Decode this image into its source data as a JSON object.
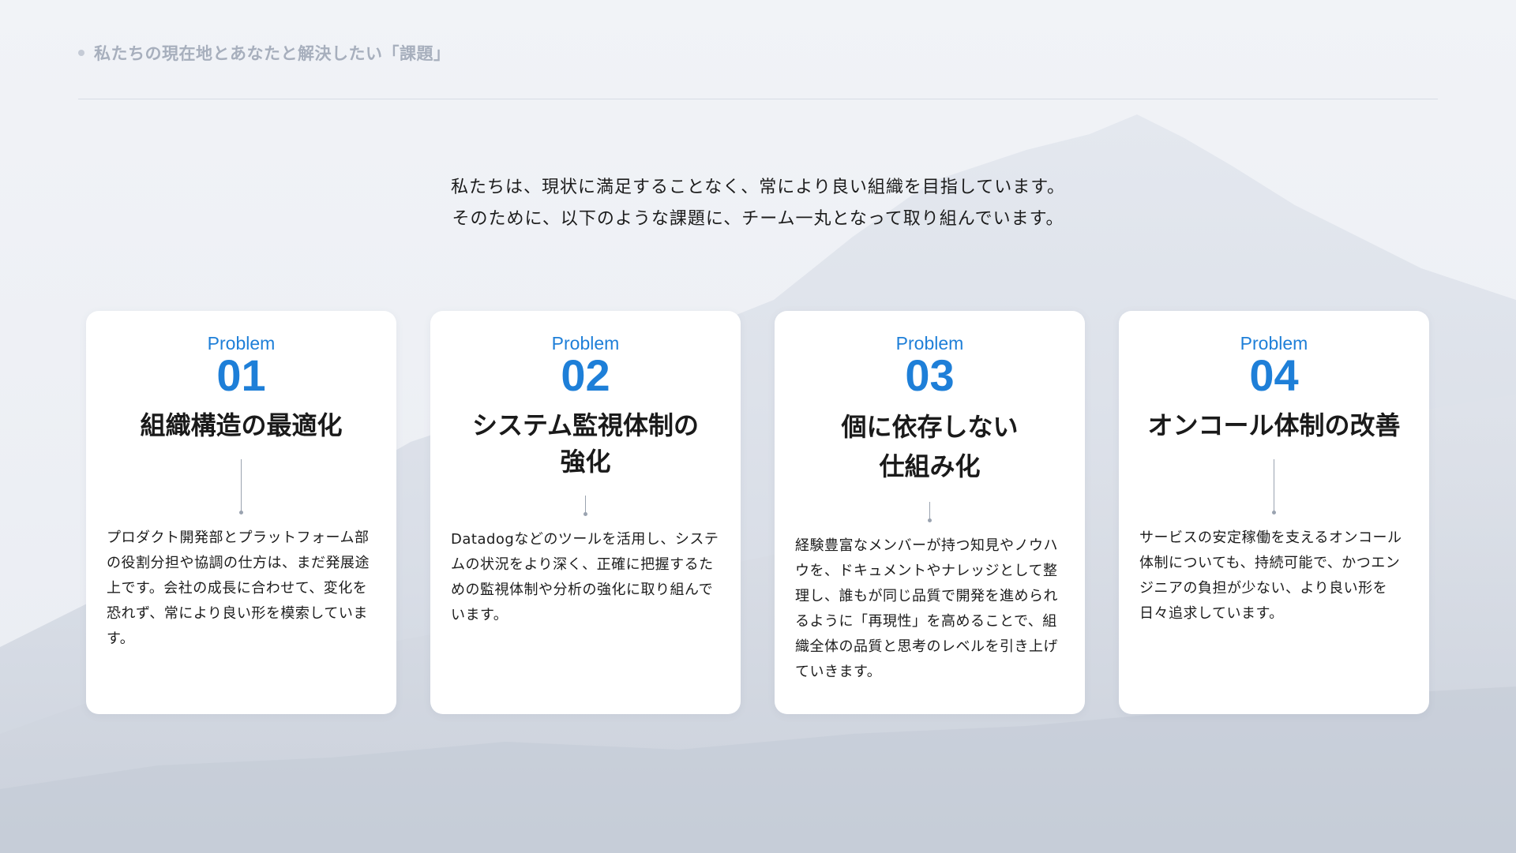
{
  "header": {
    "title": "私たちの現在地とあなたと解決したい「課題」"
  },
  "intro": {
    "line1": "私たちは、現状に満足することなく、常により良い組織を目指しています。",
    "line2": "そのために、以下のような課題に、チーム一丸となって取り組んでいます。"
  },
  "cards": [
    {
      "label": "Problem",
      "number": "01",
      "title_lines": [
        "組織構造の最適化"
      ],
      "description": "プロダクト開発部とプラットフォーム部の役割分担や協調の仕方は、まだ発展途上です。会社の成長に合わせて、変化を恐れず、常により良い形を模索しています。"
    },
    {
      "label": "Problem",
      "number": "02",
      "title_lines": [
        "システム監視体制の",
        "強化"
      ],
      "description": "Datadogなどのツールを活用し、システムの状況をより深く、正確に把握するための監視体制や分析の強化に取り組んでいます。"
    },
    {
      "label": "Problem",
      "number": "03",
      "title_lines": [
        "個に依存しない",
        "仕組み化"
      ],
      "description": "経験豊富なメンバーが持つ知見やノウハウを、ドキュメントやナレッジとして整理し、誰もが同じ品質で開発を進められるように「再現性」を高めることで、組織全体の品質と思考のレベルを引き上げていきます。"
    },
    {
      "label": "Problem",
      "number": "04",
      "title_lines": [
        "オンコール体制の改善"
      ],
      "description": "サービスの安定稼働を支えるオンコール体制についても、持続可能で、かつエンジニアの負担が少ない、より良い形を日々追求しています。"
    }
  ]
}
